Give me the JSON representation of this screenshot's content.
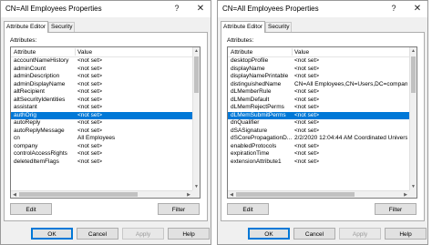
{
  "left": {
    "title": "CN=All Employees Properties",
    "help_glyph": "?",
    "close_glyph": "✕",
    "tabs": [
      "Attribute Editor",
      "Security"
    ],
    "attributes_label": "Attributes:",
    "columns": [
      "Attribute",
      "Value"
    ],
    "rows": [
      {
        "attr": "accountNameHistory",
        "value": "<not set>"
      },
      {
        "attr": "adminCount",
        "value": "<not set>"
      },
      {
        "attr": "adminDescription",
        "value": "<not set>"
      },
      {
        "attr": "adminDisplayName",
        "value": "<not set>"
      },
      {
        "attr": "altRecipient",
        "value": "<not set>"
      },
      {
        "attr": "altSecurityIdentities",
        "value": "<not set>"
      },
      {
        "attr": "assistant",
        "value": "<not set>"
      },
      {
        "attr": "authOrig",
        "value": "<not set>"
      },
      {
        "attr": "autoReply",
        "value": "<not set>"
      },
      {
        "attr": "autoReplyMessage",
        "value": "<not set>"
      },
      {
        "attr": "cn",
        "value": "All Employees"
      },
      {
        "attr": "company",
        "value": "<not set>"
      },
      {
        "attr": "controlAccessRights",
        "value": "<not set>"
      },
      {
        "attr": "deletedItemFlags",
        "value": "<not set>"
      }
    ],
    "selected_index": 7,
    "buttons": {
      "edit": "Edit",
      "filter": "Filter",
      "ok": "OK",
      "cancel": "Cancel",
      "apply": "Apply",
      "help": "Help"
    }
  },
  "right": {
    "title": "CN=All Employees Properties",
    "help_glyph": "?",
    "close_glyph": "✕",
    "tabs": [
      "Attribute Editor",
      "Security"
    ],
    "attributes_label": "Attributes:",
    "columns": [
      "Attribute",
      "Value"
    ],
    "rows": [
      {
        "attr": "desktopProfile",
        "value": "<not set>"
      },
      {
        "attr": "displayName",
        "value": "<not set>"
      },
      {
        "attr": "displayNamePrintable",
        "value": "<not set>"
      },
      {
        "attr": "distinguishedName",
        "value": "CN=All Employees,CN=Users,DC=company,"
      },
      {
        "attr": "dLMemberRule",
        "value": "<not set>"
      },
      {
        "attr": "dLMemDefault",
        "value": "<not set>"
      },
      {
        "attr": "dLMemRejectPerms",
        "value": "<not set>"
      },
      {
        "attr": "dLMemSubmitPerms",
        "value": "<not set>"
      },
      {
        "attr": "dnQualifier",
        "value": "<not set>"
      },
      {
        "attr": "dSASignature",
        "value": "<not set>"
      },
      {
        "attr": "dSCorePropagationD...",
        "value": "2/2/2020 12:04:44 AM Coordinated Universa"
      },
      {
        "attr": "enabledProtocols",
        "value": "<not set>"
      },
      {
        "attr": "expirationTime",
        "value": "<not set>"
      },
      {
        "attr": "extensionAttribute1",
        "value": "<not set>"
      }
    ],
    "selected_index": 7,
    "buttons": {
      "edit": "Edit",
      "filter": "Filter",
      "ok": "OK",
      "cancel": "Cancel",
      "apply": "Apply",
      "help": "Help"
    }
  },
  "colors": {
    "selection": "#0078d7",
    "dialog_bg": "#f0f0f0",
    "panel_bg": "#ffffff"
  },
  "icons": {
    "vscroll_up": "▲",
    "vscroll_down": "▼",
    "hscroll_left": "◀",
    "hscroll_right": "▶"
  }
}
